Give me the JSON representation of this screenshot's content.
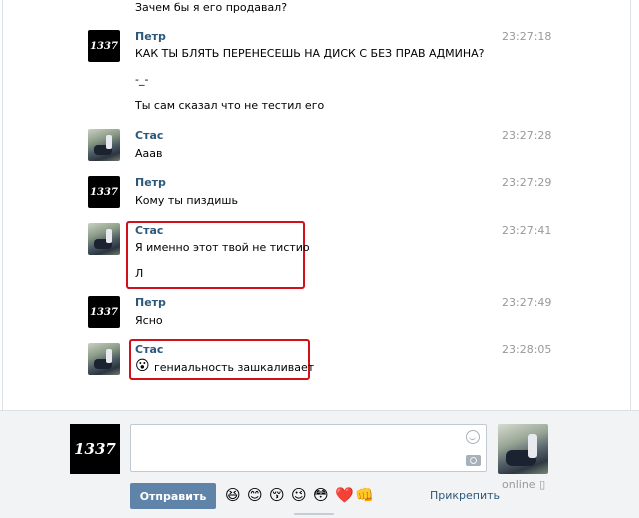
{
  "messages": [
    {
      "author": "",
      "time": "",
      "lines": [
        "Зачем бы я его продавал?"
      ]
    },
    {
      "author": "Петр",
      "time": "23:27:18",
      "avatar": "1337",
      "lines": [
        "КАК ТЫ БЛЯТЬ ПЕРЕНЕСЕШЬ НА ДИСК С БЕЗ ПРАВ АДМИНА?",
        "-_-",
        "Ты сам сказал что не тестил его"
      ]
    },
    {
      "author": "Стас",
      "time": "23:27:28",
      "avatar": "photo",
      "lines": [
        "Ааав"
      ]
    },
    {
      "author": "Петр",
      "time": "23:27:29",
      "avatar": "1337",
      "lines": [
        "Кому ты пиздишь"
      ]
    },
    {
      "author": "Стас",
      "time": "23:27:41",
      "avatar": "photo",
      "lines": [
        "Я именно этот твой не тистио",
        "Л"
      ]
    },
    {
      "author": "Петр",
      "time": "23:27:49",
      "avatar": "1337",
      "lines": [
        "Ясно"
      ]
    },
    {
      "author": "Стас",
      "time": "23:28:05",
      "avatar": "photo",
      "emoji": "😮",
      "lines": [
        "гениальность зашкаливает"
      ]
    }
  ],
  "avatar_label": "1337",
  "footer": {
    "send_label": "Отправить",
    "attach_label": "Прикрепить",
    "peer_status": "online",
    "input_value": "",
    "emojis": [
      "😆",
      "😊",
      "😚",
      "😉",
      "😳",
      "❤️",
      "👊"
    ]
  },
  "colors": {
    "accent": "#6083a9",
    "author": "#2b587a",
    "highlight": "#d0101a"
  },
  "icons": [
    "smile-icon",
    "camera-icon",
    "phone-icon"
  ]
}
